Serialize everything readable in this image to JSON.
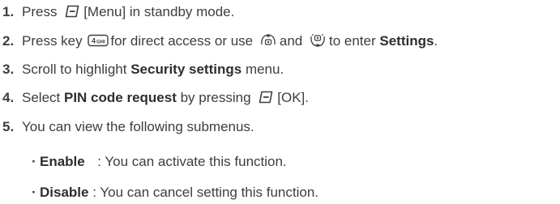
{
  "steps": [
    {
      "num": "1.",
      "pre": "Press",
      "icon": "soft-key-icon",
      "post": "[Menu] in standby mode."
    },
    {
      "num": "2.",
      "pre": "Press key",
      "icon": "key-4-ghi-icon",
      "icon_text": "4",
      "icon_subtext": "GHI",
      "mid1": "for direct access or use",
      "icon2": "nav-up-icon",
      "mid2": "and",
      "icon3": "nav-down-icon",
      "mid3": "to enter",
      "bold": "Settings",
      "post": "."
    },
    {
      "num": "3.",
      "pre": "Scroll to highlight",
      "bold": "Security settings",
      "post": "menu."
    },
    {
      "num": "4.",
      "pre": "Select",
      "bold": "PIN code request",
      "mid": "by pressing",
      "icon": "soft-key-icon",
      "post": "[OK]."
    },
    {
      "num": "5.",
      "text": "You can view the following submenus."
    }
  ],
  "submenus": [
    {
      "bullet": "·",
      "name": "Enable",
      "desc": ": You can activate this function."
    },
    {
      "bullet": "·",
      "name": "Disable",
      "desc": ": You can cancel setting this function."
    }
  ]
}
